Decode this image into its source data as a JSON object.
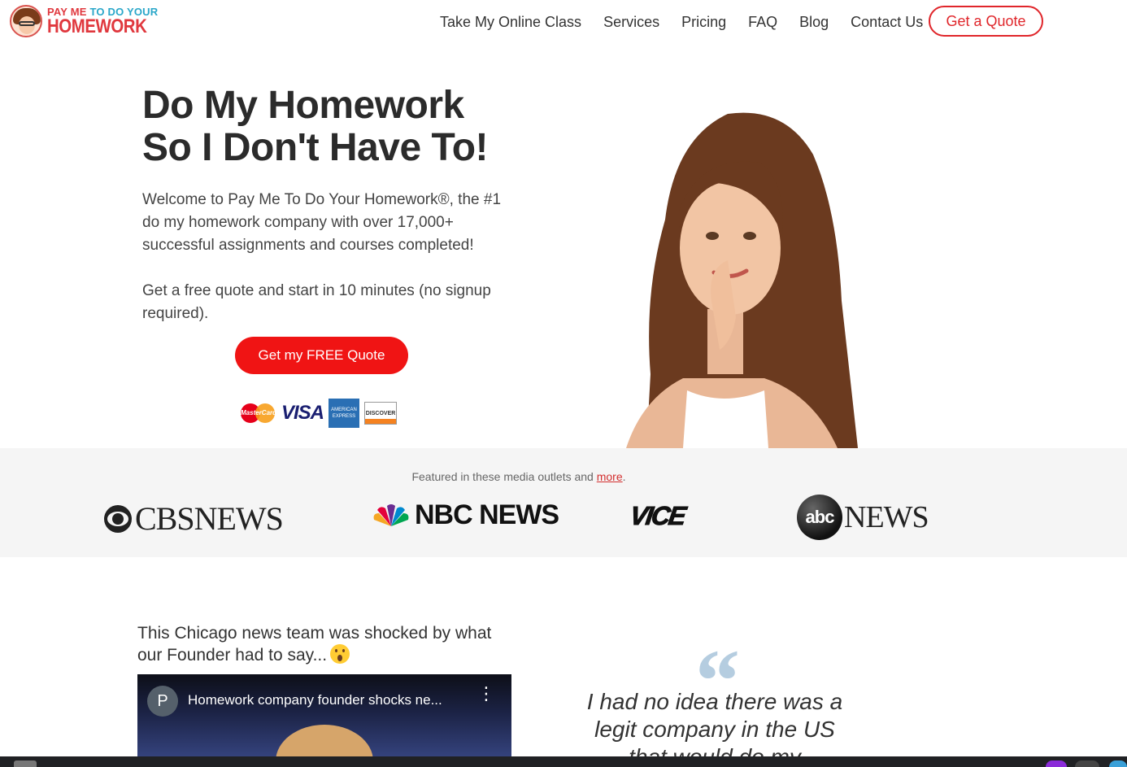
{
  "logo": {
    "top_part1": "PAY ME",
    "top_part2": "TO DO YOUR",
    "bottom": "HOMEWORK"
  },
  "nav": {
    "items": [
      "Take My Online Class",
      "Services",
      "Pricing",
      "FAQ",
      "Blog",
      "Contact Us"
    ],
    "cta": "Get a Quote"
  },
  "hero": {
    "title_line1": "Do My Homework",
    "title_line2": "So I Don't Have To!",
    "paragraph1": "Welcome to Pay Me To Do Your Homework®, the #1 do my homework company with over 17,000+ successful assignments and courses completed!",
    "paragraph2": "Get a free quote and start in 10 minutes (no signup required).",
    "button": "Get my FREE Quote",
    "cards": {
      "mastercard": "MasterCard",
      "visa": "VISA",
      "amex": "AMERICAN EXPRESS",
      "discover": "DISCOVER"
    }
  },
  "media": {
    "text": "Featured in these media outlets and",
    "link": "more",
    "period": ".",
    "logos": {
      "cbs": "CBSNEWS",
      "nbc": "NBC NEWS",
      "vice": "VICE",
      "abc_ball": "abc",
      "abc_text": "NEWS"
    }
  },
  "video_section": {
    "heading": "This Chicago news team was shocked by what our Founder had to say...",
    "video_avatar": "P",
    "video_title": "Homework company founder shocks ne...",
    "menu": "⋮"
  },
  "testimonial": {
    "quote_mark": "“",
    "text": "I had no idea there was a legit company in the US that would do my"
  },
  "colors": {
    "accent": "#f01414",
    "quote_mark": "#b5cde0",
    "media_bg": "#f5f5f5"
  }
}
